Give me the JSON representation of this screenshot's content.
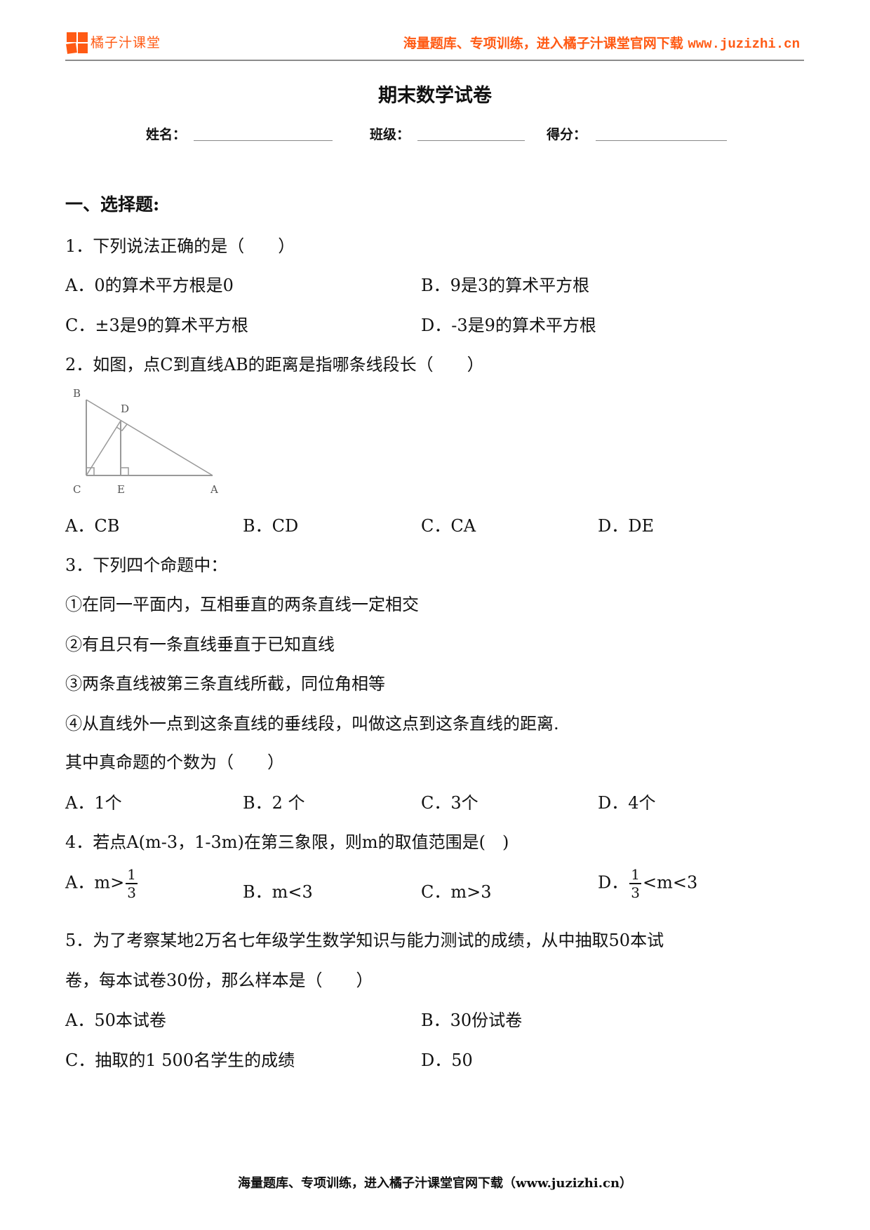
{
  "header": {
    "brand": "橘子汁课堂",
    "slogan": "海量题库、专项训练，进入橘子汁课堂官网下载",
    "url": "www.juzizhi.cn",
    "accent_color": "#ff5a14"
  },
  "title": "期末数学试卷",
  "fields": [
    {
      "label": "姓名："
    },
    {
      "label": "班级："
    },
    {
      "label": "得分："
    }
  ],
  "section": "一、选择题:",
  "questions": [
    {
      "stem": "1．下列说法正确的是（　　）",
      "options": [
        "A．0的算术平方根是0",
        "B．9是3的算术平方根",
        "C．±3是9的算术平方根",
        "D．-3是9的算术平方根"
      ]
    },
    {
      "stem": "2．如图，点C到直线AB的距离是指哪条线段长（　　）",
      "figure_labels": {
        "B": "B",
        "D": "D",
        "C": "C",
        "E": "E",
        "A": "A"
      },
      "options": [
        "A．CB",
        "B．CD",
        "C．CA",
        "D．DE"
      ]
    },
    {
      "stem": "3．下列四个命题中：",
      "statements": [
        "①在同一平面内，互相垂直的两条直线一定相交",
        "②有且只有一条直线垂直于已知直线",
        "③两条直线被第三条直线所截，同位角相等",
        "④从直线外一点到这条直线的垂线段，叫做这点到这条直线的距离."
      ],
      "prompt": "其中真命题的个数为（　　）",
      "options": [
        "A．1个",
        "B．2 个",
        "C．3个",
        "D．4个"
      ]
    },
    {
      "stem": "4．若点A(m-3，1-3m)在第三象限，则m的取值范围是(　)",
      "options": [
        {
          "prefix": "A．m>",
          "num": "1",
          "den": "3",
          "suffix": ""
        },
        {
          "prefix": "B．m<3"
        },
        {
          "prefix": "C．m>3"
        },
        {
          "prefix": "D．",
          "num": "1",
          "den": "3",
          "suffix": "<m<3"
        }
      ]
    },
    {
      "stem_line1": "5．为了考察某地2万名七年级学生数学知识与能力测试的成绩，从中抽取50本试",
      "stem_line2": "卷，每本试卷30份，那么样本是（　　）",
      "options": [
        "A．50本试卷",
        "B．30份试卷",
        "C．抽取的1 500名学生的成绩",
        "D．50"
      ]
    }
  ],
  "footer": "海量题库、专项训练，进入橘子汁课堂官网下载（www.juzizhi.cn）"
}
